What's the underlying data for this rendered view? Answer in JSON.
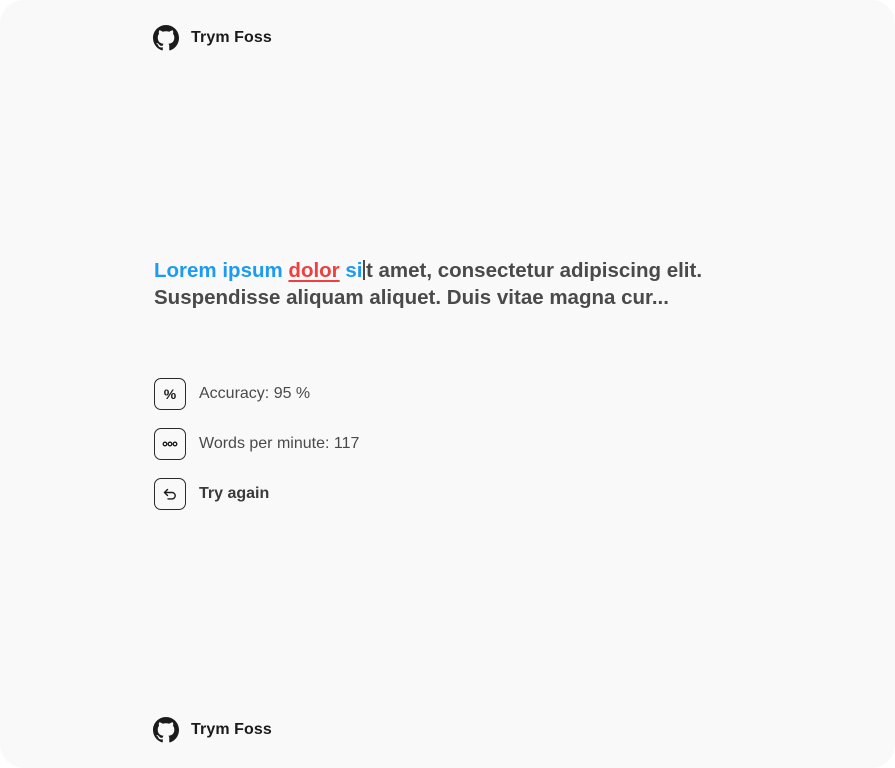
{
  "brand": {
    "name": "Trym Foss",
    "icon": "github-icon"
  },
  "typing": {
    "typed_correct": "Lorem ipsum ",
    "typed_error": "dolor",
    "typed_after_error": " si",
    "remaining": "t amet, consectetur adipiscing elit. Suspendisse  aliquam aliquet. Duis vitae magna cur...",
    "colors": {
      "typed": "#1e9bef",
      "error": "#ee4040",
      "remaining": "#4a4a4a"
    }
  },
  "stats": {
    "accuracy_icon": "%",
    "accuracy_label": "Accuracy: 95 %",
    "wpm_icon": "ellipsis-icon",
    "wpm_label": "Words per minute: 117",
    "retry_icon": "undo-icon",
    "retry_label": "Try again"
  }
}
